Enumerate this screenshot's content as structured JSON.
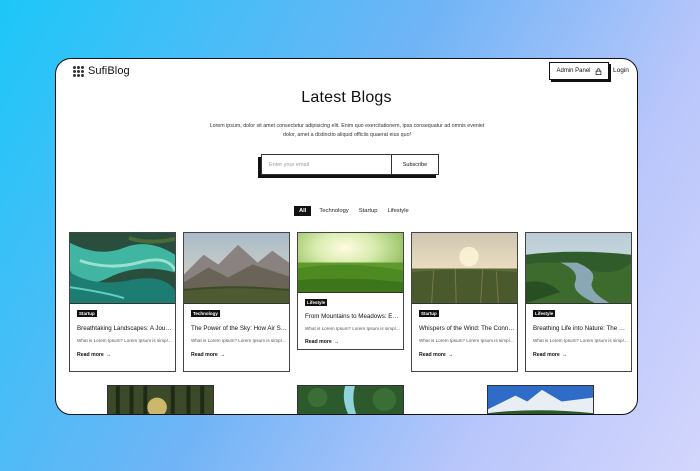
{
  "header": {
    "logo_text": "SufiBlog",
    "admin_label": "Admin Panel",
    "login_label": "Login"
  },
  "hero": {
    "title": "Latest Blogs",
    "description": "Lorem ipsum, dolor sit amet consectetur adipisicing elit. Enim quo exercitationem, ipsa consequatur ad omnis eveniet dolor, amet a distinctio aliquid officiis quaerat eius quo!"
  },
  "subscribe": {
    "placeholder": "Enter your email",
    "button_label": "Subscribe"
  },
  "filters": [
    "All",
    "Technology",
    "Startup",
    "Lifestyle"
  ],
  "active_filter": "All",
  "posts": [
    {
      "tag": "Startup",
      "title": "Breathtaking Landscapes: A Journey",
      "excerpt": "What is Lorem Ipsum? Lorem Ipsum is simply dummy text",
      "read_more": "Read more",
      "image": "aerial-river-delta"
    },
    {
      "tag": "Technology",
      "title": "The Power of the Sky: How Air Shapes",
      "excerpt": "What is Lorem Ipsum? Lorem Ipsum is simply dummy text",
      "read_more": "Read more",
      "image": "mountain-valley"
    },
    {
      "tag": "Lifestyle",
      "title": "From Mountains to Meadows: Exploring",
      "excerpt": "What is Lorem Ipsum? Lorem Ipsum is simply dummy text",
      "read_more": "Read more",
      "image": "sunny-meadow"
    },
    {
      "tag": "Startup",
      "title": "Whispers of the Wind: The Connection",
      "excerpt": "What is Lorem Ipsum? Lorem Ipsum is simply dummy text",
      "read_more": "Read more",
      "image": "grass-field-fog"
    },
    {
      "tag": "Lifestyle",
      "title": "Breathing Life into Nature: The Story",
      "excerpt": "What is Lorem Ipsum? Lorem Ipsum is simply dummy text",
      "read_more": "Read more",
      "image": "forest-river"
    }
  ],
  "second_row_images": [
    "forest-sunlight",
    "waterfall-forest",
    "snow-mountain"
  ],
  "colors": {
    "accent": "#111111",
    "background_gradient": [
      "#1cc7f8",
      "#d3d6fc"
    ]
  }
}
